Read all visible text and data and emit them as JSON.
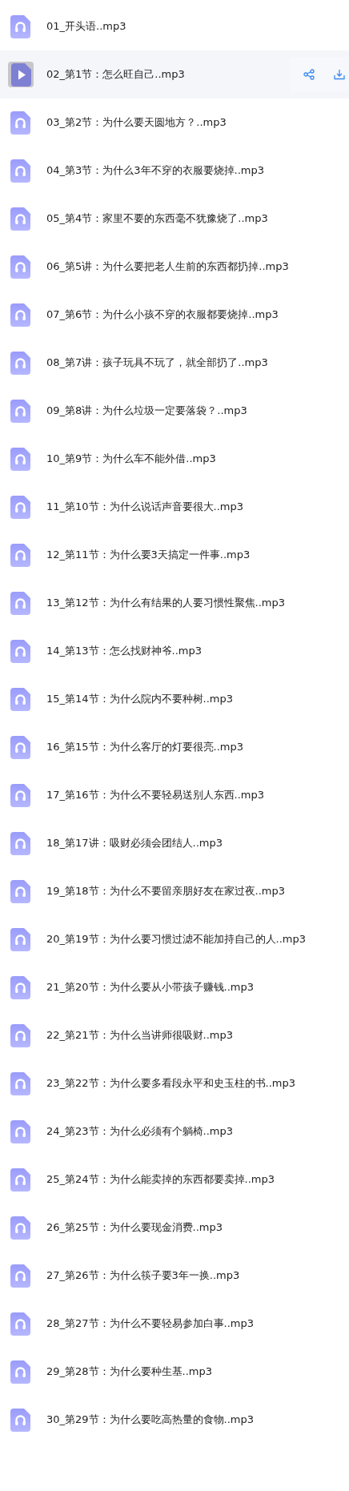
{
  "files": [
    {
      "name": "01_开头语..mp3",
      "selected": false
    },
    {
      "name": "02_第1节：怎么旺自己..mp3",
      "selected": true
    },
    {
      "name": "03_第2节：为什么要天圆地方？..mp3",
      "selected": false
    },
    {
      "name": "04_第3节：为什么3年不穿的衣服要烧掉..mp3",
      "selected": false
    },
    {
      "name": "05_第4节：家里不要的东西毫不犹豫烧了..mp3",
      "selected": false
    },
    {
      "name": "06_第5讲：为什么要把老人生前的东西都扔掉..mp3",
      "selected": false
    },
    {
      "name": "07_第6节：为什么小孩不穿的衣服都要烧掉..mp3",
      "selected": false
    },
    {
      "name": "08_第7讲：孩子玩具不玩了，就全部扔了..mp3",
      "selected": false
    },
    {
      "name": "09_第8讲：为什么垃圾一定要落袋？..mp3",
      "selected": false
    },
    {
      "name": "10_第9节：为什么车不能外借..mp3",
      "selected": false
    },
    {
      "name": "11_第10节：为什么说话声音要很大..mp3",
      "selected": false
    },
    {
      "name": "12_第11节：为什么要3天搞定一件事..mp3",
      "selected": false
    },
    {
      "name": "13_第12节：为什么有结果的人要习惯性聚焦..mp3",
      "selected": false
    },
    {
      "name": "14_第13节：怎么找财神爷..mp3",
      "selected": false
    },
    {
      "name": "15_第14节：为什么院内不要种树..mp3",
      "selected": false
    },
    {
      "name": "16_第15节：为什么客厅的灯要很亮..mp3",
      "selected": false
    },
    {
      "name": "17_第16节：为什么不要轻易送别人东西..mp3",
      "selected": false
    },
    {
      "name": "18_第17讲：吸财必须会团结人..mp3",
      "selected": false
    },
    {
      "name": "19_第18节：为什么不要留亲朋好友在家过夜..mp3",
      "selected": false
    },
    {
      "name": "20_第19节：为什么要习惯过滤不能加持自己的人..mp3",
      "selected": false
    },
    {
      "name": "21_第20节：为什么要从小带孩子赚钱..mp3",
      "selected": false
    },
    {
      "name": "22_第21节：为什么当讲师很吸财..mp3",
      "selected": false
    },
    {
      "name": "23_第22节：为什么要多看段永平和史玉柱的书..mp3",
      "selected": false
    },
    {
      "name": "24_第23节：为什么必须有个躺椅..mp3",
      "selected": false
    },
    {
      "name": "25_第24节：为什么能卖掉的东西都要卖掉..mp3",
      "selected": false
    },
    {
      "name": "26_第25节：为什么要现金消费..mp3",
      "selected": false
    },
    {
      "name": "27_第26节：为什么筷子要3年一换..mp3",
      "selected": false
    },
    {
      "name": "28_第27节：为什么不要轻易参加白事..mp3",
      "selected": false
    },
    {
      "name": "29_第28节：为什么要种生基..mp3",
      "selected": false
    },
    {
      "name": "30_第29节：为什么要吃高热量的食物..mp3",
      "selected": false
    }
  ]
}
